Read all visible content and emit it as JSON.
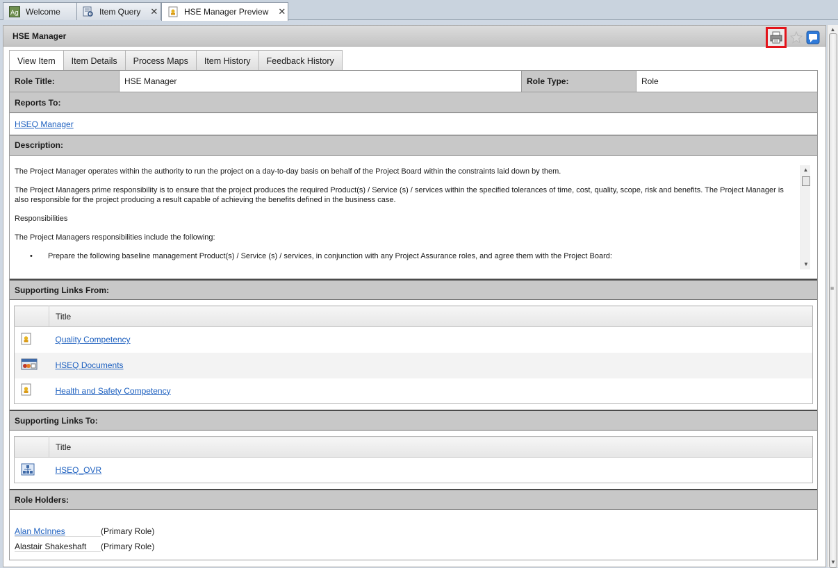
{
  "tabs": [
    {
      "label": "Welcome",
      "icon": "app-logo-icon"
    },
    {
      "label": "Item Query",
      "icon": "query-icon"
    },
    {
      "label": "HSE Manager Preview",
      "icon": "role-document-icon"
    }
  ],
  "panel": {
    "title": "HSE Manager"
  },
  "subtabs": [
    "View Item",
    "Item Details",
    "Process Maps",
    "Item History",
    "Feedback History"
  ],
  "role": {
    "title_label": "Role Title:",
    "title_value": "HSE Manager",
    "type_label": "Role Type:",
    "type_value": "Role"
  },
  "reports_to": {
    "label": "Reports To:",
    "link": "HSEQ Manager"
  },
  "description": {
    "label": "Description:",
    "paragraphs": [
      "The Project Manager operates within the authority to run the project on a day-to-day basis on behalf of the Project Board within the constraints laid down by them.",
      "The Project Managers prime responsibility is to ensure that the project produces the required Product(s) / Service (s) / services within the specified tolerances of time, cost, quality, scope, risk and benefits.  The Project Manager is also responsible for the project producing a result capable of achieving the benefits defined in the business case.",
      "Responsibilities",
      "The Project Managers responsibilities include the following:"
    ],
    "bullet": "Prepare the following baseline management Product(s) / Service (s) / services, in conjunction with any Project Assurance roles, and agree them with the Project Board:"
  },
  "links_from": {
    "label": "Supporting Links From:",
    "column": "Title",
    "rows": [
      {
        "title": "Quality Competency",
        "icon": "competency-icon"
      },
      {
        "title": "HSEQ Documents",
        "icon": "documents-group-icon"
      },
      {
        "title": "Health and Safety Competency",
        "icon": "competency-icon"
      }
    ]
  },
  "links_to": {
    "label": "Supporting Links To:",
    "column": "Title",
    "rows": [
      {
        "title": "HSEQ_OVR",
        "icon": "org-chart-icon"
      }
    ]
  },
  "role_holders": {
    "label": "Role Holders:",
    "holders": [
      {
        "name": "Alan McInnes",
        "role": "(Primary Role)",
        "linked": true
      },
      {
        "name": "Alastair Shakeshaft",
        "role": "(Primary Role)",
        "linked": false
      }
    ]
  }
}
